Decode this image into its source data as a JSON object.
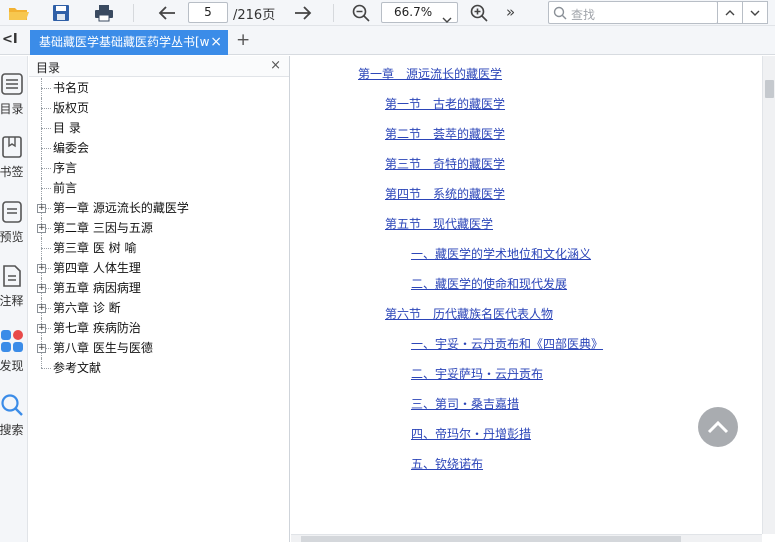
{
  "toolbar": {
    "page_current": "5",
    "page_total": "/216页",
    "zoom": "66.7%",
    "more": "»",
    "search_placeholder": "查找"
  },
  "tab": {
    "title": "基础藏医学基础藏医药学丛书[w",
    "close": "×",
    "add": "+",
    "collapse": "<I"
  },
  "rail": {
    "items": [
      {
        "label": "目录",
        "icon": "list-icon"
      },
      {
        "label": "书签",
        "icon": "bookmark-icon"
      },
      {
        "label": "预览",
        "icon": "preview-icon"
      },
      {
        "label": "注释",
        "icon": "note-icon"
      },
      {
        "label": "发现",
        "icon": "discover-icon"
      },
      {
        "label": "搜索",
        "icon": "search-icon"
      }
    ]
  },
  "outline": {
    "title": "目录",
    "close": "×",
    "nodes": [
      {
        "label": "书名页",
        "expandable": false
      },
      {
        "label": "版权页",
        "expandable": false
      },
      {
        "label": "目 录",
        "expandable": false
      },
      {
        "label": "编委会",
        "expandable": false
      },
      {
        "label": "序言",
        "expandable": false
      },
      {
        "label": "前言",
        "expandable": false
      },
      {
        "label": "第一章 源远流长的藏医学",
        "expandable": true
      },
      {
        "label": "第二章 三因与五源",
        "expandable": true
      },
      {
        "label": "第三章 医 树 喻",
        "expandable": false
      },
      {
        "label": "第四章 人体生理",
        "expandable": true
      },
      {
        "label": "第五章 病因病理",
        "expandable": true
      },
      {
        "label": "第六章 诊 断",
        "expandable": true
      },
      {
        "label": "第七章 疾病防治",
        "expandable": true
      },
      {
        "label": "第八章 医生与医德",
        "expandable": true
      },
      {
        "label": "参考文献",
        "expandable": false
      }
    ]
  },
  "document": {
    "lines": [
      {
        "text": "第一章　源远流长的藏医学",
        "level": 0
      },
      {
        "text": "第一节　古老的藏医学",
        "level": 1
      },
      {
        "text": "第二节　荟萃的藏医学",
        "level": 1
      },
      {
        "text": "第三节　奇特的藏医学",
        "level": 1
      },
      {
        "text": "第四节　系统的藏医学",
        "level": 1
      },
      {
        "text": "第五节　现代藏医学",
        "level": 1
      },
      {
        "text": "一、藏医学的学术地位和文化涵义",
        "level": 2
      },
      {
        "text": "二、藏医学的使命和现代发展",
        "level": 2
      },
      {
        "text": "第六节　历代藏族名医代表人物",
        "level": 1
      },
      {
        "text": "一、宇妥・云丹贡布和《四部医典》",
        "level": 2
      },
      {
        "text": "二、宇妥萨玛・云丹贡布",
        "level": 2
      },
      {
        "text": "三、第司・桑吉嘉措",
        "level": 2
      },
      {
        "text": "四、帝玛尔・丹增彭措",
        "level": 2
      },
      {
        "text": "五、钦绕诺布",
        "level": 2
      }
    ]
  },
  "colors": {
    "accent": "#3b8ce8",
    "link": "#2b45b8",
    "toolbar_bg": "#f4f6f9"
  }
}
